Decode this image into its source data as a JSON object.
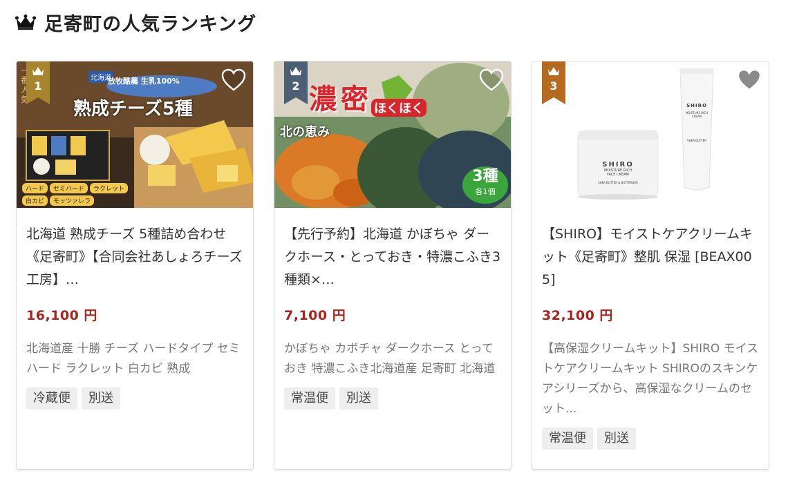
{
  "heading": {
    "title": "足寄町の人気ランキング",
    "icon": "crown-icon"
  },
  "colors": {
    "price": "#a8241c",
    "rank1": "#a8842e",
    "rank2": "#4d5f75",
    "rank3": "#b56a1f"
  },
  "products": [
    {
      "rank": "1",
      "image_text": {
        "region": "北海道",
        "brand": "放牧酪農 生乳100%",
        "headline": "熟成チーズ5種",
        "corner": "一番人気",
        "labels": [
          "ハード",
          "セミハード",
          "ラクレット",
          "白カビ",
          "モッツァレラ"
        ]
      },
      "name": "北海道 熟成チーズ 5種詰め合わせ《足寄町》【合同会社あしょろチーズ工房】…",
      "price": "16,100 円",
      "description": "北海道産 十勝 チーズ ハードタイプ セミハード ラクレット 白カビ 熟成",
      "tags": [
        "冷蔵便",
        "別送"
      ]
    },
    {
      "rank": "2",
      "image_text": {
        "headline": "濃密",
        "sub": "ほくほく",
        "tagline": "北の恵み",
        "badge_main": "3種",
        "badge_sub": "各1個"
      },
      "name": "【先行予約】北海道 かぼちゃ ダークホース・とっておき・特濃こふき3種類×…",
      "price": "7,100 円",
      "description": "かぼちゃ カボチャ ダークホース とっておき 特濃こふき北海道産 足寄町 北海道",
      "tags": [
        "常温便",
        "別送"
      ]
    },
    {
      "rank": "3",
      "image_text": {
        "jar_brand": "SHIRO",
        "jar_line1": "MOISTURE RICH",
        "jar_line2": "FACE CREAM",
        "jar_small": "SHEA BUTTER & BUTTERBUR",
        "tube_brand": "SHIRO",
        "tube_line1": "MOISTURE RICH",
        "tube_line2": "CREAM",
        "tube_small": "SHEA BUTTER"
      },
      "name": "【SHIRO】モイストケアクリームキット《足寄町》整肌 保湿 [BEAX005]",
      "price": "32,100 円",
      "description": "【高保湿クリームキット】SHIRO モイストケアクリームキット SHIROのスキンケアシリーズから、高保湿なクリームのセット...",
      "tags": [
        "常温便",
        "別送"
      ]
    }
  ]
}
